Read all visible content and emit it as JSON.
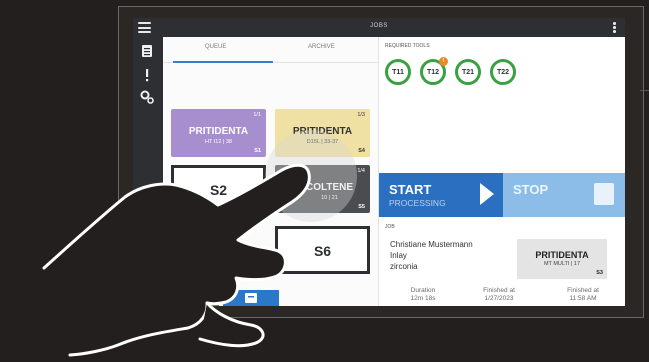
{
  "topbar": {
    "title": "JOBS"
  },
  "tabs": [
    {
      "label": "QUEUE"
    },
    {
      "label": "ARCHIVE"
    }
  ],
  "queue": {
    "cards": [
      {
        "brand": "PRITIDENTA",
        "sub": "HT I12 | 38",
        "slot": "S1",
        "count": "1/1",
        "bg": "#a78fcf"
      },
      {
        "brand": "PRITIDENTA",
        "sub": "D15L | 33-37",
        "slot": "S4",
        "count": "1/3",
        "bg": "#efe0a4"
      },
      {
        "brand": "COLTENE",
        "sub": "10 | 21",
        "slot": "S5",
        "count": "1/4",
        "bg": "#4a4c4f"
      }
    ],
    "empty_slots": [
      {
        "label": "S2"
      },
      {
        "label": "S6"
      }
    ]
  },
  "required_tools": {
    "label": "REQUIRED TOOLS",
    "tools": [
      {
        "name": "T11",
        "warning": false
      },
      {
        "name": "T12",
        "warning": true
      },
      {
        "name": "T21",
        "warning": false
      },
      {
        "name": "T22",
        "warning": false
      }
    ],
    "ring_color": "#3aa143",
    "warning_color": "#e88a2a"
  },
  "actions": {
    "start": {
      "line1": "START",
      "line2": "PROCESSING"
    },
    "stop": {
      "line1": "STOP"
    }
  },
  "job": {
    "label": "JOB",
    "customer": "Christiane Mustermann",
    "type": "Inlay",
    "material": "zirconia",
    "card": {
      "brand": "PRITIDENTA",
      "sub": "MT MULTI | 17",
      "slot": "S3"
    },
    "stats": [
      {
        "label": "Duration",
        "value": "12m 18s"
      },
      {
        "label": "Finished at",
        "value": "1/27/2023"
      },
      {
        "label": "Finished at",
        "value": "11:58 AM"
      }
    ],
    "pager": {
      "pages": 3,
      "active": 2
    }
  },
  "colors": {
    "accent_blue": "#2b6fc1",
    "stop_blue": "#8bbde8",
    "nav_dark": "#2d2f33"
  }
}
